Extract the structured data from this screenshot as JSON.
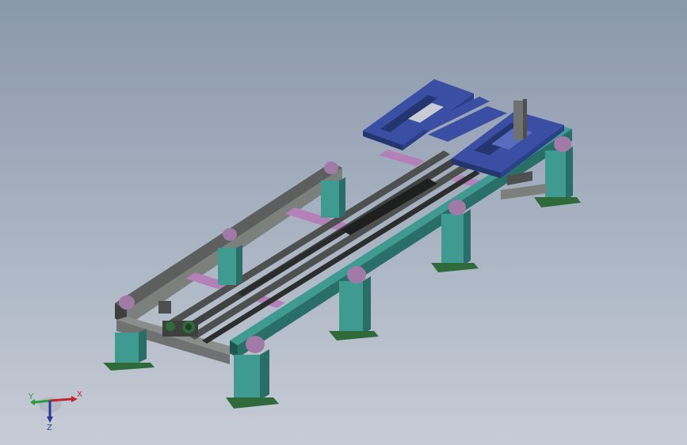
{
  "triad": {
    "x_label": "X",
    "y_label": "Y",
    "z_label": "Z"
  },
  "colors": {
    "background_top": "#8a98ab",
    "background_bottom": "#c7ccd6",
    "teal_steel": "#3f9a92",
    "teal_dark": "#2a6e69",
    "grey_steel": "#6f7270",
    "grey_dark": "#3d403e",
    "blue_frame": "#3a4fa3",
    "blue_dark": "#24356f",
    "purple_plate": "#a27aa8",
    "pink_crossbar": "#b57fb7",
    "green_motor": "#2f6a3a",
    "axis_x": "#c0282d",
    "axis_y": "#2a9a3b",
    "axis_z": "#2b3a9a"
  }
}
